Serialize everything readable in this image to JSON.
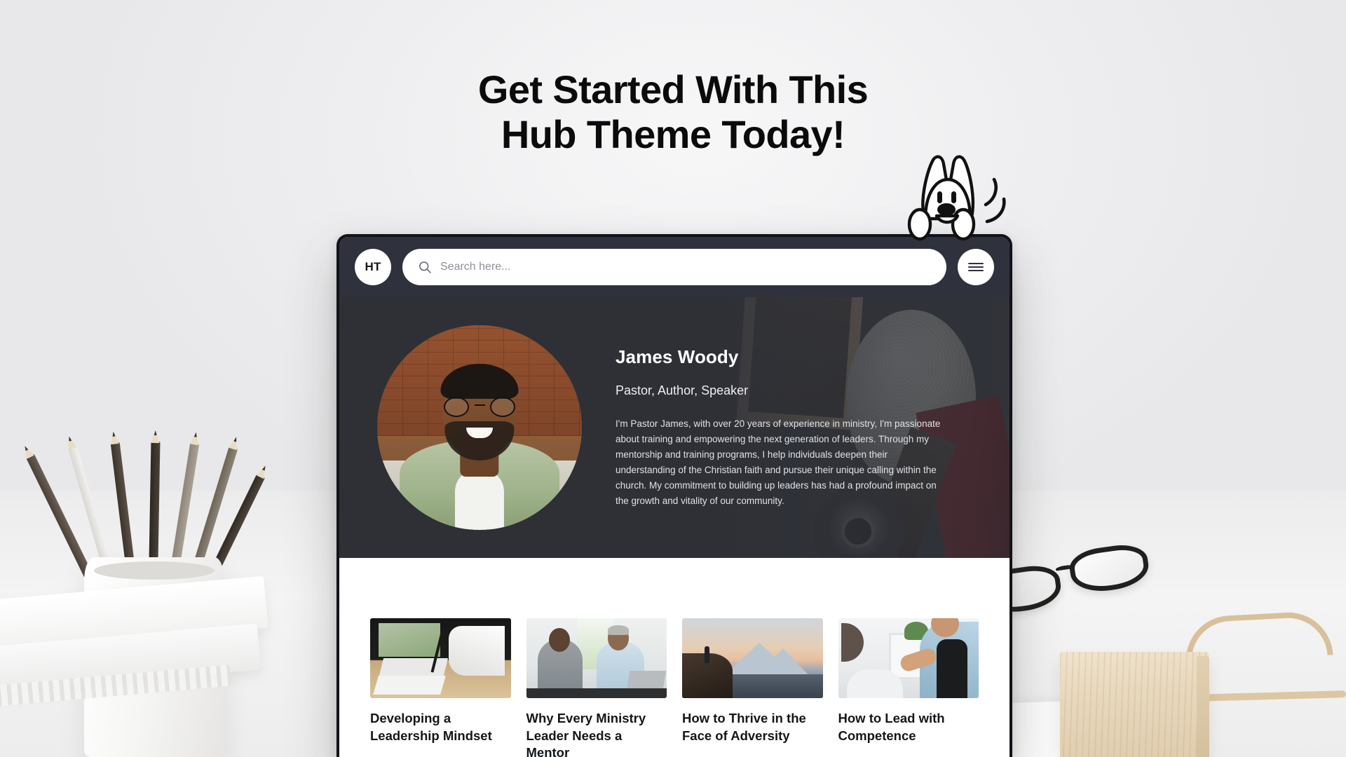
{
  "headline": {
    "line1": "Get Started With This",
    "line2": "Hub Theme Today!"
  },
  "colors": {
    "page_background": "#eeeef0",
    "navbar": "#2f323c",
    "hero_background": "#33353c",
    "headline_text": "#0b0b0b",
    "card_title_text": "#14161a",
    "accent_white": "#ffffff"
  },
  "navbar": {
    "logo_text": "HT",
    "search_placeholder": "Search here...",
    "search_value": "",
    "search_icon": "search-icon",
    "menu_icon": "hamburger-menu-icon"
  },
  "hero": {
    "avatar_alt": "portrait-of-james-woody",
    "name": "James Woody",
    "role": "Pastor, Author, Speaker",
    "bio": "I'm Pastor James, with over 20 years of experience in ministry, I'm passionate about training and empowering the next generation of leaders. Through my mentorship and training programs, I help individuals deepen their understanding of the Christian faith and pursue their unique calling within the church. My commitment to building up leaders has had a profound impact on the growth and vitality of our community."
  },
  "cards": [
    {
      "title": "Developing a Leadership Mindset",
      "thumb": "desk-writing-photo"
    },
    {
      "title": "Why Every Ministry Leader Needs a Mentor",
      "thumb": "two-men-at-laptop-photo"
    },
    {
      "title": "How to Thrive in the Face of Adversity",
      "thumb": "mountain-cliff-sunset-photo"
    },
    {
      "title": "How to Lead with Competence",
      "thumb": "office-handshake-photo"
    }
  ],
  "background": {
    "scene": "bright-white-desk-scene",
    "objects": [
      "pencil-cup",
      "notebook-stack",
      "eyeglasses",
      "wooden-block",
      "brass-wire-holder"
    ]
  },
  "mascot": {
    "name": "waving-bunny-mascot"
  }
}
